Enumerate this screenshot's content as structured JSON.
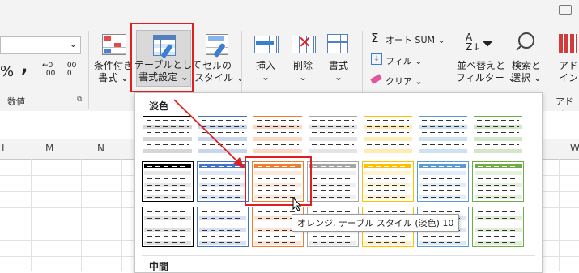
{
  "ribbon": {
    "font_size_value": "",
    "percent_symbol": "%",
    "comma_symbol": ",",
    "inc_decimal": ".00",
    "dec_decimal": ".0",
    "number_group_label": "数値",
    "cond_format_label1": "条件付き",
    "cond_format_label2": "書式 ⌄",
    "table_format_label1": "テーブルとして",
    "table_format_label2": "書式設定 ⌄",
    "cell_style_label1": "セルの",
    "cell_style_label2": "スタイル ⌄",
    "insert_label": "挿入",
    "insert_caret": "⌄",
    "delete_label": "削除",
    "delete_caret": "⌄",
    "format_label": "書式",
    "format_caret": "⌄",
    "autosum_label": "オート SUM  ⌄",
    "fill_label": "フィル ⌄",
    "clear_label": "クリア ⌄",
    "sort_label1": "並べ替えと",
    "sort_label2": "フィルター ⌄",
    "find_label1": "検索と",
    "find_label2": "選択 ⌄",
    "addin_label1": "アド",
    "addin_label2": "イン",
    "addin_group_label": "アドイン"
  },
  "columns": [
    "L",
    "M",
    "N",
    "W"
  ],
  "gallery": {
    "section_light": "淡色",
    "section_medium": "中間",
    "accent_colors": [
      "#777777",
      "#4472c4",
      "#ed7d31",
      "#a5a5a5",
      "#ffc000",
      "#5b9bd5",
      "#70ad47"
    ]
  },
  "tooltip": "オレンジ, テーブル スタイル (淡色) 10",
  "colors": {
    "highlight_red": "#e02020"
  }
}
